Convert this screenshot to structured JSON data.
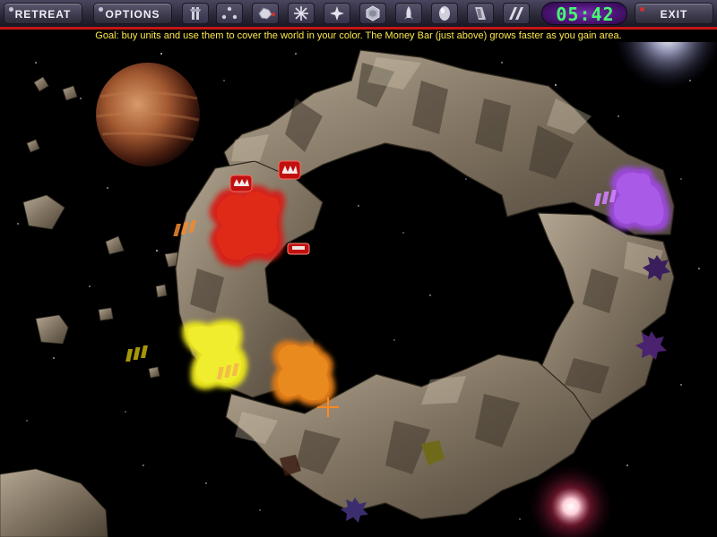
{
  "toolbar": {
    "retreat_label": "RETREAT",
    "options_label": "OPTIONS",
    "exit_label": "EXIT",
    "tools": [
      {
        "name": "tool-unit-a-icon"
      },
      {
        "name": "tool-unit-b-icon"
      },
      {
        "name": "tool-unit-c-icon"
      },
      {
        "name": "tool-star-icon"
      },
      {
        "name": "tool-crosshair-icon"
      },
      {
        "name": "tool-gem-icon"
      },
      {
        "name": "tool-rocket-icon"
      },
      {
        "name": "tool-egg-icon"
      },
      {
        "name": "tool-wall-icon"
      },
      {
        "name": "tool-barrier-icon"
      }
    ]
  },
  "timer": {
    "value": "05:42"
  },
  "goal_text": "Goal: buy units and use them to cover the world in your color.  The Money Bar (just above) grows faster as you gain area.",
  "territories": [
    {
      "name": "red-territory",
      "color": "#d81a12"
    },
    {
      "name": "purple-territory",
      "color": "#9a4ad8"
    },
    {
      "name": "yellow-territory",
      "color": "#e8e41a"
    },
    {
      "name": "orange-territory",
      "color": "#e07a14"
    }
  ],
  "colors": {
    "space": "#000000",
    "rock": "#7a6c5c",
    "toolbar": "#3c3a4c",
    "accent_red": "#c41616",
    "timer_text": "#44ff70",
    "goal_text": "#ffe84a"
  }
}
